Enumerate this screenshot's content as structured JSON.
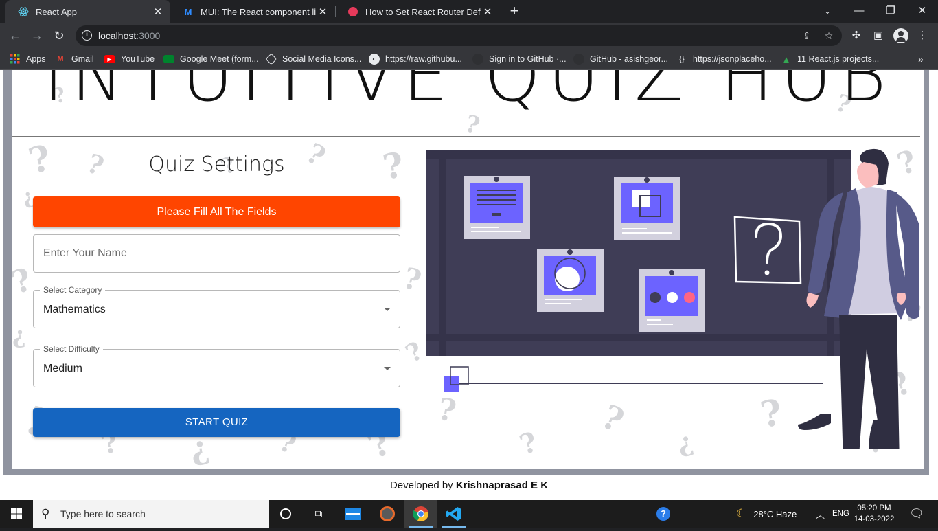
{
  "browser": {
    "tabs": [
      {
        "title": "React App",
        "active": true
      },
      {
        "title": "MUI: The React component librar",
        "active": false
      },
      {
        "title": "How to Set React Router Default",
        "active": false
      }
    ],
    "url_host": "localhost",
    "url_port": ":3000",
    "bookmarks": [
      "Apps",
      "Gmail",
      "YouTube",
      "Google Meet (form...",
      "Social Media Icons...",
      "https://raw.githubu...",
      "Sign in to GitHub ·...",
      "GitHub - asishgeor...",
      "https://jsonplaceho...",
      "11 React.js projects..."
    ]
  },
  "page": {
    "hero_title": "INTUITIVE QUIZ HUB",
    "settings_title": "Quiz Settings",
    "alert_text": "Please Fill All The Fields",
    "name_placeholder": "Enter Your Name",
    "category_label": "Select Category",
    "category_value": "Mathematics",
    "difficulty_label": "Select Difficulty",
    "difficulty_value": "Medium",
    "start_button": "START QUIZ",
    "footer_prefix": "Developed by",
    "footer_author": "Krishnaprasad E K"
  },
  "colors": {
    "alert": "#ff4500",
    "start_button": "#1565c0",
    "illustration_board": "#3f3d56",
    "illustration_accent": "#6c63ff"
  },
  "taskbar": {
    "search_placeholder": "Type here to search",
    "weather": "28°C  Haze",
    "language": "ENG",
    "time": "05:20 PM",
    "date": "14-03-2022"
  }
}
